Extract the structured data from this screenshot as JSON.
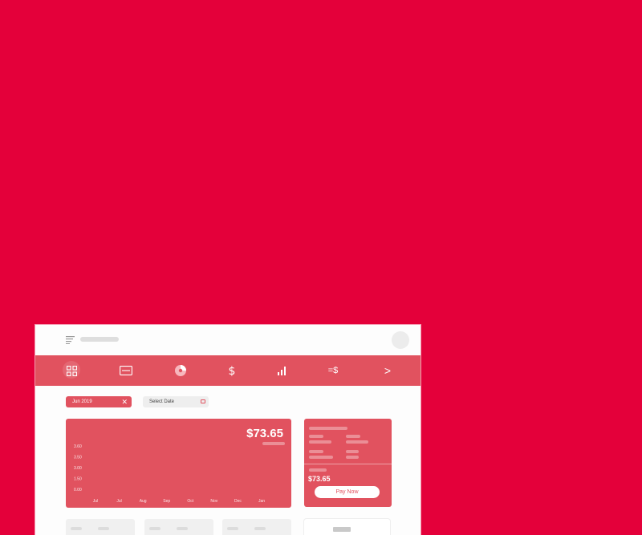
{
  "nav": {
    "items": [
      {
        "icon": "grid-icon",
        "active": true
      },
      {
        "icon": "card-icon"
      },
      {
        "icon": "pie-chart-icon"
      },
      {
        "icon": "dollar-icon"
      },
      {
        "icon": "bar-chart-icon"
      },
      {
        "icon": "convert-currency-icon",
        "label": "=$"
      },
      {
        "icon": "chevron-right-icon",
        "label": ">"
      }
    ]
  },
  "filters": {
    "active_chip": "Jun 2019",
    "clear_symbol": "✕",
    "date_select_label": "Select Date"
  },
  "balance_chart": {
    "amount": "$73.65"
  },
  "payment_card": {
    "amount": "$73.65",
    "pay_label": "Pay Now"
  },
  "colors": {
    "background": "#e4003a",
    "accent": "#e1525f",
    "window": "#fdfdfd"
  },
  "chart_data": {
    "type": "line",
    "categories": [
      "Jul",
      "Jul",
      "Aug",
      "Sep",
      "Oct",
      "Nov",
      "Dec",
      "Jan"
    ],
    "y_ticks": [
      "0.00",
      "1.50",
      "3.00",
      "3.50",
      "3.60"
    ],
    "series": [],
    "grid": false,
    "title": "",
    "xlabel": "",
    "ylabel": ""
  }
}
